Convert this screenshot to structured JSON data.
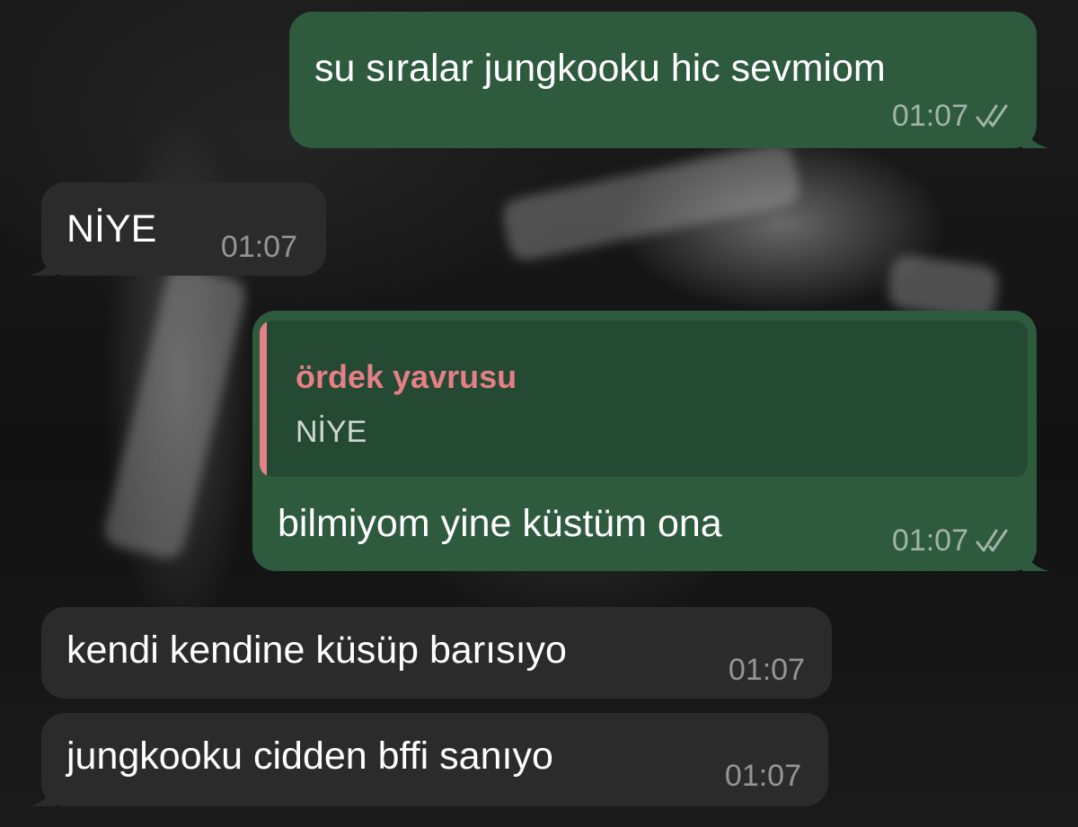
{
  "theme": {
    "outgoing_bubble": "#2e5a3e",
    "incoming_bubble": "#2b2b2b",
    "reply_background": "#244a33",
    "reply_accent": "#e77f86"
  },
  "messages": [
    {
      "direction": "outgoing",
      "text": "su sıralar jungkooku hic sevmiom",
      "time": "01:07",
      "status_icon": "double-check-icon"
    },
    {
      "direction": "incoming",
      "text": "NİYE",
      "time": "01:07"
    },
    {
      "direction": "outgoing",
      "reply": {
        "author": "ördek yavrusu",
        "text": "NİYE"
      },
      "text": "bilmiyom yine küstüm ona",
      "time": "01:07",
      "status_icon": "double-check-icon"
    },
    {
      "direction": "incoming",
      "text": "kendi kendine küsüp barısıyo",
      "time": "01:07"
    },
    {
      "direction": "incoming",
      "text": "jungkooku cidden bffi sanıyo",
      "time": "01:07"
    }
  ]
}
